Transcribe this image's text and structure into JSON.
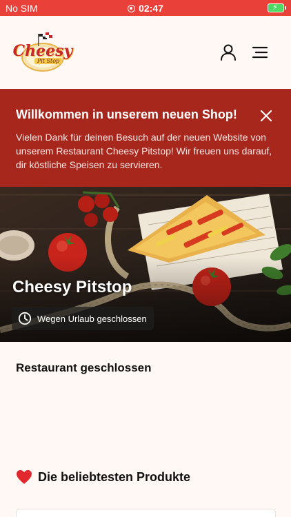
{
  "statusbar": {
    "carrier": "No SIM",
    "time": "02:47"
  },
  "header": {
    "logo": {
      "main": "Cheesy",
      "sub": "Pit Stop"
    }
  },
  "banner": {
    "title": "Willkommen in unserem neuen Shop!",
    "text": "Vielen Dank für deinen Besuch auf der neuen Website von unserem Restaurant Cheesy Pitstop! Wir freuen uns darauf, dir köstliche Speisen zu servieren."
  },
  "hero": {
    "title": "Cheesy Pitstop",
    "status": "Wegen Urlaub geschlossen"
  },
  "main": {
    "closed_title": "Restaurant geschlossen",
    "popular_title": "Die beliebtesten Produkte"
  },
  "colors": {
    "statusbar": "#e9403a",
    "banner": "#a8271d",
    "background": "#fff8f5"
  }
}
